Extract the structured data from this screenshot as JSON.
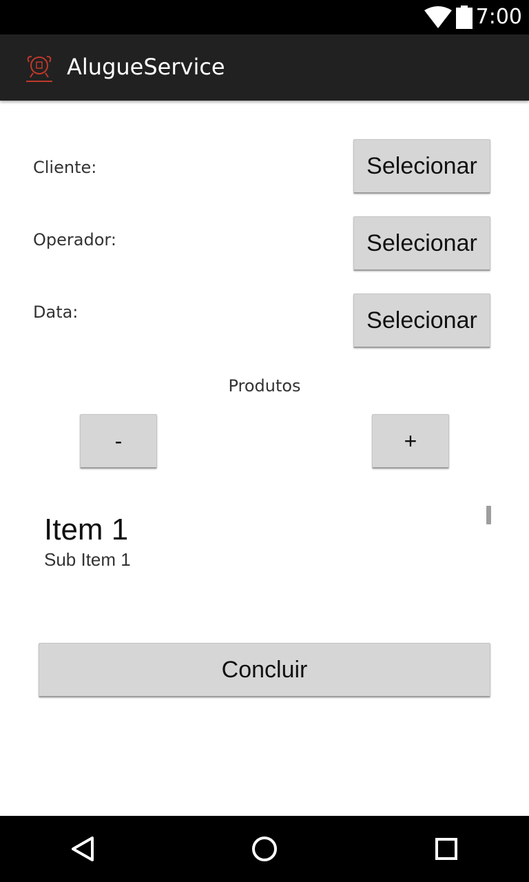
{
  "status_bar": {
    "time": "7:00",
    "icons": [
      "wifi-icon",
      "battery-icon"
    ]
  },
  "action_bar": {
    "app_icon": "app-logo-icon",
    "title": "AlugueService"
  },
  "form": {
    "cliente": {
      "label": "Cliente:",
      "button": "Selecionar"
    },
    "operador": {
      "label": "Operador:",
      "button": "Selecionar"
    },
    "data": {
      "label": "Data:",
      "button": "Selecionar"
    }
  },
  "produtos": {
    "title": "Produtos",
    "remove_label": "-",
    "add_label": "+",
    "items": [
      {
        "title": "Item 1",
        "subtitle": "Sub Item 1"
      }
    ]
  },
  "footer": {
    "concluir_label": "Concluir"
  },
  "nav_bar": {
    "icons": [
      "back-icon",
      "home-icon",
      "recents-icon"
    ]
  },
  "colors": {
    "status_bar": "#000000",
    "action_bar": "#212121",
    "button": "#d6d6d6",
    "logo_accent": "#c0392b"
  }
}
